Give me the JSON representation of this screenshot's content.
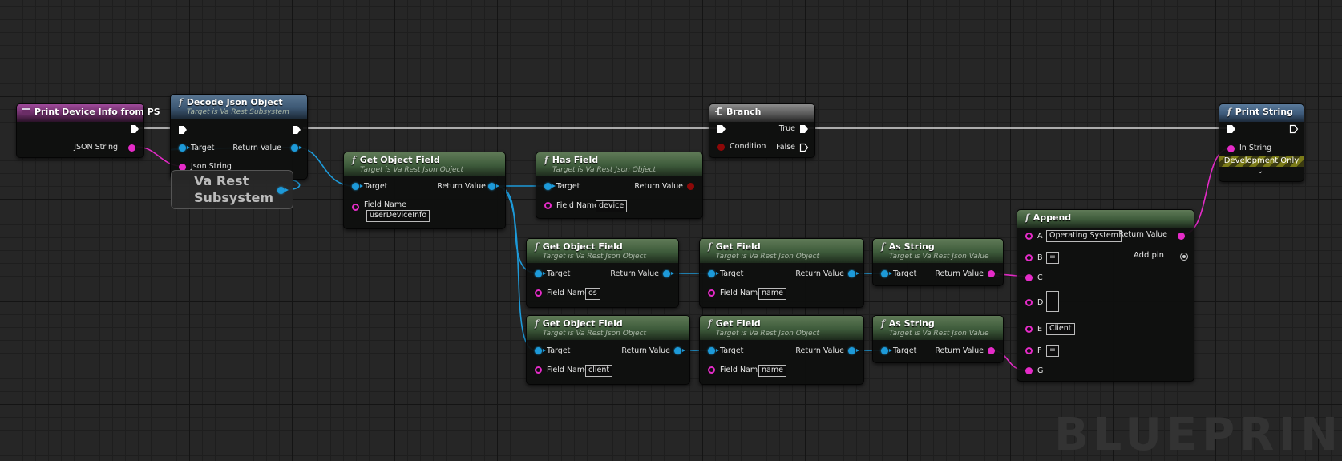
{
  "colors": {
    "exec": "#ffffff",
    "object": "#1d9ad9",
    "string": "#e52bc8",
    "bool": "#8d0808",
    "function_header": "#3d5a3a"
  },
  "event": {
    "title": "Print Device Info from PS",
    "json_string": "JSON String"
  },
  "decode": {
    "title": "Decode Json Object",
    "subtitle": "Target is Va Rest Subsystem",
    "target": "Target",
    "return_value": "Return Value",
    "json_string": "Json String"
  },
  "va_rest": {
    "line1": "Va Rest",
    "line2": "Subsystem"
  },
  "get_object_field_1": {
    "title": "Get Object Field",
    "subtitle": "Target is Va Rest Json Object",
    "target": "Target",
    "return_value": "Return Value",
    "field_name_label": "Field Name",
    "field_name": "userDeviceInfo"
  },
  "has_field": {
    "title": "Has Field",
    "subtitle": "Target is Va Rest Json Object",
    "target": "Target",
    "return_value": "Return Value",
    "field_name_label": "Field Name",
    "field_name": "device"
  },
  "branch": {
    "title": "Branch",
    "condition": "Condition",
    "true_label": "True",
    "false_label": "False"
  },
  "print_string": {
    "title": "Print String",
    "in_string": "In String",
    "development_only": "Development Only"
  },
  "get_object_field_2": {
    "title": "Get Object Field",
    "subtitle": "Target is Va Rest Json Object",
    "target": "Target",
    "return_value": "Return Value",
    "field_name_label": "Field Name",
    "field_name": "os"
  },
  "get_field_1": {
    "title": "Get Field",
    "subtitle": "Target is Va Rest Json Object",
    "target": "Target",
    "return_value": "Return Value",
    "field_name_label": "Field Name",
    "field_name": "name"
  },
  "as_string_1": {
    "title": "As String",
    "subtitle": "Target is Va Rest Json Value",
    "target": "Target",
    "return_value": "Return Value"
  },
  "get_object_field_3": {
    "title": "Get Object Field",
    "subtitle": "Target is Va Rest Json Object",
    "target": "Target",
    "return_value": "Return Value",
    "field_name_label": "Field Name",
    "field_name": "client"
  },
  "get_field_2": {
    "title": "Get Field",
    "subtitle": "Target is Va Rest Json Object",
    "target": "Target",
    "return_value": "Return Value",
    "field_name_label": "Field Name",
    "field_name": "name"
  },
  "as_string_2": {
    "title": "As String",
    "subtitle": "Target is Va Rest Json Value",
    "target": "Target",
    "return_value": "Return Value"
  },
  "append": {
    "title": "Append",
    "return_value": "Return Value",
    "add_pin": "Add pin",
    "pins": {
      "a": "A",
      "a_value": "Operating System",
      "b": "B",
      "b_value": "=",
      "c": "C",
      "d": "D",
      "e": "E",
      "e_value": "Client",
      "f": "F",
      "f_value": "=",
      "g": "G"
    }
  },
  "watermark": "BLUEPRINT"
}
